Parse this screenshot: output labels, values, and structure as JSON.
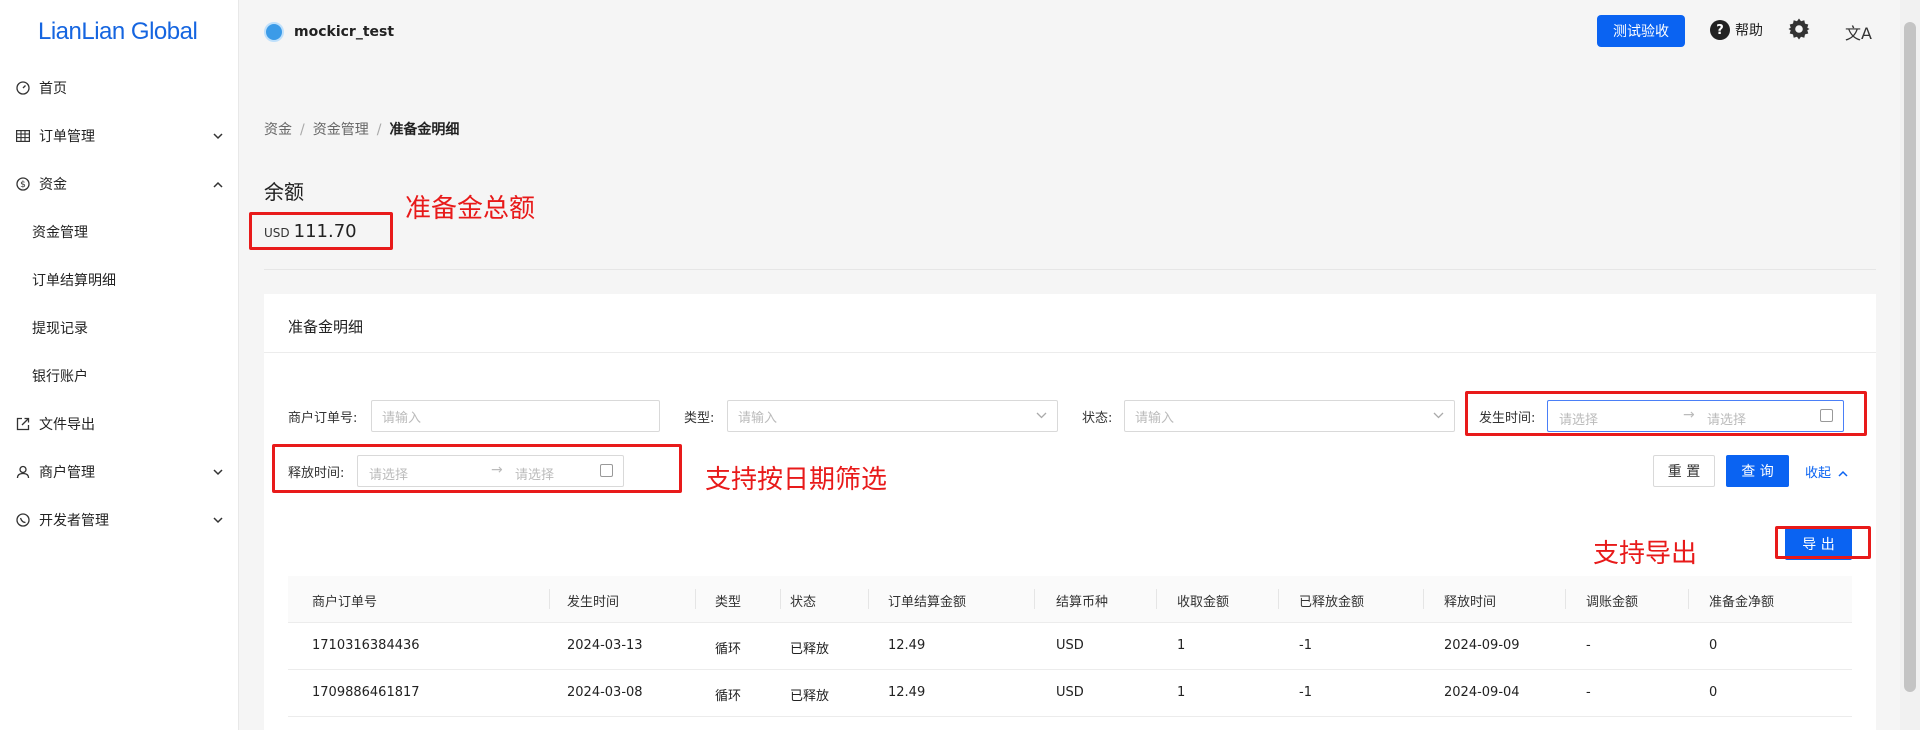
{
  "sidebar": {
    "logo": "LianLian Global",
    "items": [
      {
        "label": "首页",
        "icon": "dashboard-icon"
      },
      {
        "label": "订单管理",
        "icon": "table-icon"
      },
      {
        "label": "资金",
        "icon": "dollar-icon"
      },
      {
        "label": "资金管理"
      },
      {
        "label": "订单结算明细"
      },
      {
        "label": "提现记录"
      },
      {
        "label": "银行账户"
      },
      {
        "label": "文件导出",
        "icon": "export-icon"
      },
      {
        "label": "商户管理",
        "icon": "user-icon"
      },
      {
        "label": "开发者管理",
        "icon": "developer-icon"
      }
    ]
  },
  "header": {
    "user": "mockicr_test",
    "test_button": "测试验收",
    "help": "帮助",
    "help_icon": "?",
    "lang_icon": "文A"
  },
  "breadcrumb": [
    "资金",
    "资金管理",
    "准备金明细"
  ],
  "balance": {
    "title": "余额",
    "currency": "USD",
    "amount": "111.70"
  },
  "annotations": {
    "total": "准备金总额",
    "date_filter": "支持按日期筛选",
    "export": "支持导出"
  },
  "card": {
    "title": "准备金明细",
    "filters": {
      "order_no_label": "商户订单号",
      "order_no_placeholder": "请输入",
      "type_label": "类型",
      "type_placeholder": "请输入",
      "status_label": "状态",
      "status_placeholder": "请输入",
      "occur_time_label": "发生时间",
      "release_time_label": "释放时间",
      "date_placeholder": "请选择",
      "separator": ":"
    },
    "buttons": {
      "reset": "重 置",
      "search": "查 询",
      "collapse": "收起",
      "export": "导 出"
    },
    "table": {
      "columns": [
        "商户订单号",
        "发生时间",
        "类型",
        "状态",
        "订单结算金额",
        "结算币种",
        "收取金额",
        "已释放金额",
        "释放时间",
        "调账金额",
        "准备金净额"
      ],
      "rows": [
        [
          "1710316384436",
          "2024-03-13",
          "循环",
          "已释放",
          "12.49",
          "USD",
          "1",
          "-1",
          "2024-09-09",
          "-",
          "0"
        ],
        [
          "1709886461817",
          "2024-03-08",
          "循环",
          "已释放",
          "12.49",
          "USD",
          "1",
          "-1",
          "2024-09-04",
          "-",
          "0"
        ]
      ]
    }
  },
  "colors": {
    "primary": "#0a63f2",
    "annotation": "#e81a1a",
    "logo": "#1565e0"
  }
}
